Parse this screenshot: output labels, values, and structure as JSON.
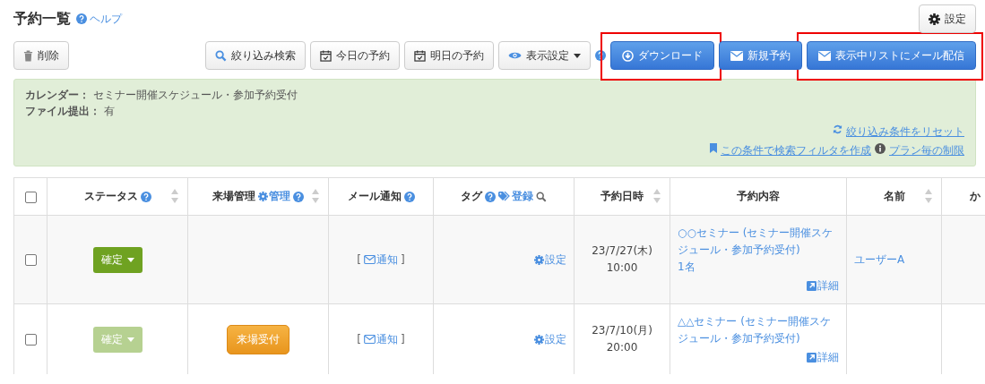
{
  "header": {
    "title": "予約一覧",
    "help_link": "ヘルプ",
    "settings_button": "設定"
  },
  "toolbar": {
    "left": [
      {
        "label": "削除",
        "kind": "delete",
        "highlighted": false
      }
    ],
    "right": [
      {
        "label": "絞り込み検索",
        "kind": "search",
        "highlighted": false
      },
      {
        "label": "今日の予約",
        "kind": "today",
        "highlighted": false
      },
      {
        "label": "明日の予約",
        "kind": "tomorrow",
        "highlighted": false
      },
      {
        "label": "表示設定",
        "kind": "display",
        "highlighted": false
      },
      {
        "kind": "help"
      },
      {
        "label": "ダウンロード",
        "kind": "download",
        "highlighted": true
      },
      {
        "label": "新規予約",
        "kind": "new",
        "highlighted": false
      },
      {
        "label": "表示中リストにメール配信",
        "kind": "mail",
        "highlighted": true
      }
    ]
  },
  "filter_panel": {
    "conditions": [
      {
        "label": "カレンダー：",
        "value": "セミナー開催スケジュール・参加予約受付"
      },
      {
        "label": "ファイル提出：",
        "value": "有"
      }
    ],
    "link_rows": [
      [
        {
          "label": "絞り込み条件をリセット",
          "kind": "reset"
        }
      ],
      [
        {
          "label": "この条件で検索フィルタを作成",
          "kind": "save"
        },
        {
          "label": "プラン毎の制限",
          "kind": "info"
        }
      ]
    ]
  },
  "table": {
    "select_all_checked": false,
    "columns": [
      {
        "label": "ステータス",
        "help": true,
        "sortable": true
      },
      {
        "label": "来場管理",
        "link": "管理",
        "help": true,
        "sortable": true
      },
      {
        "label": "メール通知",
        "help": true,
        "sortable": false
      },
      {
        "label": "タグ",
        "help": true,
        "tag_link": "登録",
        "sortable": false
      },
      {
        "label": "予約日時",
        "help": false,
        "sortable": true
      },
      {
        "label": "予約内容",
        "help": false,
        "sortable": false
      },
      {
        "label": "名前",
        "help": false,
        "sortable": true
      },
      {
        "label": "か",
        "help": false
      }
    ],
    "rows": [
      {
        "checked": false,
        "status": {
          "label": "確定",
          "faded": false
        },
        "notify": {
          "open": "[",
          "label": "通知",
          "close": "]"
        },
        "tag_action": "設定",
        "date": "23/7/27(木)",
        "time": "10:00",
        "content": "○○セミナー (セミナー開催スケジュール・参加予約受付)",
        "count": "1名",
        "detail": "詳細",
        "name": "ユーザーA"
      },
      {
        "checked": false,
        "status": {
          "label": "確定",
          "faded": true
        },
        "visit_button": "来場受付",
        "notify": {
          "open": "[",
          "label": "通知",
          "close": "]"
        },
        "tag_action": "設定",
        "date": "23/7/10(月)",
        "time": "20:00",
        "content": "△△セミナー (セミナー開催スケジュール・参加予約受付)",
        "detail": "詳細"
      }
    ]
  }
}
